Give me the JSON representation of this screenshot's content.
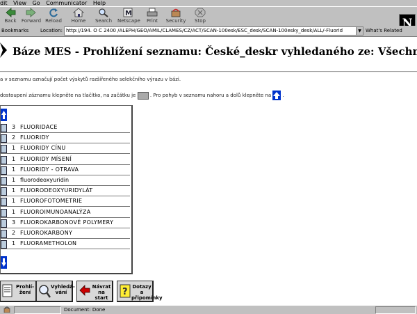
{
  "menu": [
    "Edit",
    "View",
    "Go",
    "Communicator",
    "Help"
  ],
  "toolbar": [
    {
      "label": "Back",
      "icon": "back-arrow-icon"
    },
    {
      "label": "Forward",
      "icon": "forward-arrow-icon"
    },
    {
      "label": "Reload",
      "icon": "reload-icon"
    },
    {
      "label": "Home",
      "icon": "home-icon"
    },
    {
      "label": "Search",
      "icon": "search-icon"
    },
    {
      "label": "Netscape",
      "icon": "netscape-icon"
    },
    {
      "label": "Print",
      "icon": "print-icon"
    },
    {
      "label": "Security",
      "icon": "security-icon"
    },
    {
      "label": "Stop",
      "icon": "stop-icon"
    }
  ],
  "location": {
    "bookmarks": "Bookmarks",
    "label": "Location:",
    "url": "http://194.  O  C  2400 /ALEPH/GEO/AMIL/CLAMES/CZ/ACT/SCAN-100esk/ESC_desk/SCAN-100esky_desk/ALL/-Fluorid",
    "related": "What's Related"
  },
  "page": {
    "title": "Báze MES - Prohlížení seznamu: České_deskr vyhledaného ze: Všechny_deskr",
    "info1": "a v seznamu označují počet výskytů rozšířeného selekčního výrazu v bázi.",
    "info2_a": "dostoupení záznamu klepněte na tlačítko, na začátku je",
    "info2_b": ". Pro pohyb v seznamu nahoru a dolů klepněte na",
    "info2_c": "."
  },
  "list": [
    {
      "count": "3",
      "term": "FLUORIDACE"
    },
    {
      "count": "2",
      "term": "FLUORIDY"
    },
    {
      "count": "1",
      "term": "FLUORIDY CÍNU"
    },
    {
      "count": "1",
      "term": "FLUORIDY MÍSENÍ"
    },
    {
      "count": "1",
      "term": "FLUORIDY - OTRAVA"
    },
    {
      "count": "1",
      "term": "fluorodeoxyuridin"
    },
    {
      "count": "1",
      "term": "FLUORODEOXYURIDYLÁT"
    },
    {
      "count": "1",
      "term": "FLUOROFOTOMETRIE"
    },
    {
      "count": "1",
      "term": "FLUOROIMUNOANALÝZA"
    },
    {
      "count": "3",
      "term": "FLUOROKARBONOVÉ POLYMERY"
    },
    {
      "count": "2",
      "term": "FLUOROKARBONY"
    },
    {
      "count": "1",
      "term": "FLUORAMETHOLON"
    }
  ],
  "buttons": [
    {
      "label1": "Prohlí-",
      "label2": "žení",
      "icon": "browse-icon"
    },
    {
      "label1": "Vyhledá-",
      "label2": "vání",
      "icon": "magnifier-icon"
    },
    {
      "label1": "Návrat",
      "label2": "na start",
      "icon": "return-arrow-icon"
    },
    {
      "label1": "Dotazy a",
      "label2": "připomínky",
      "icon": "question-icon"
    }
  ],
  "status": {
    "text": "Document: Done"
  },
  "colors": {
    "chrome": "#c0c0c0",
    "arrow_blue": "#0033cc",
    "stop_red": "#cc0000",
    "content_bg": "#ffffff"
  }
}
